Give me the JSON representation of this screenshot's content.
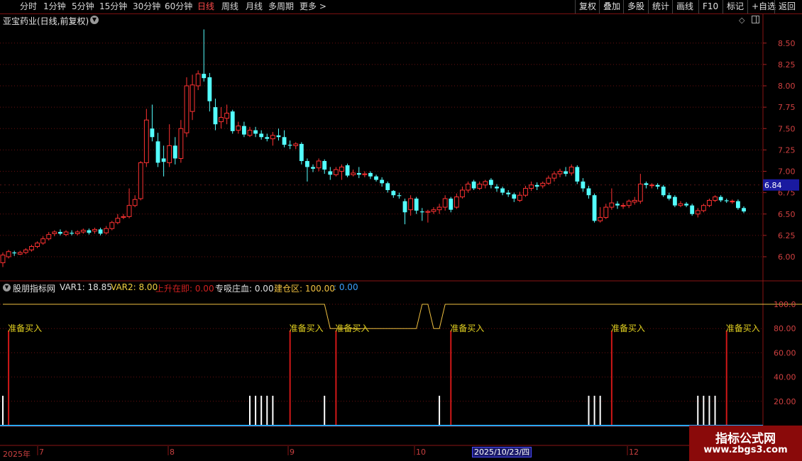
{
  "toolbar": {
    "periods": [
      "分时",
      "1分钟",
      "5分钟",
      "15分钟",
      "30分钟",
      "60分钟",
      "日线",
      "周线",
      "月线",
      "多周期",
      "更多 >"
    ],
    "active_period": "日线",
    "right_buttons": [
      "复权",
      "叠加",
      "多股",
      "统计",
      "画线",
      "F10",
      "标记",
      "+自选",
      "返回"
    ]
  },
  "stock": {
    "title": "亚宝药业(日线,前复权)"
  },
  "price_axis": {
    "ticks": [
      "8.50",
      "8.25",
      "8.00",
      "7.75",
      "7.50",
      "7.25",
      "7.00",
      "6.75",
      "6.50",
      "6.25",
      "6.00"
    ],
    "current": "6.84"
  },
  "indicator": {
    "name": "股朋指标网",
    "var1": "VAR1: 18.85",
    "var2": "VAR2: 8.00",
    "rise": "上升在即: 0.00",
    "absorb": "专吸庄血: 0.00",
    "build": "建仓区: 100.00",
    "extra": ": 0.00",
    "axis": [
      "100.0",
      "80.00",
      "60.00",
      "40.00",
      "20.00"
    ],
    "buy_label": "准备买入"
  },
  "dates": {
    "year": "2025年",
    "months": [
      "7",
      "8",
      "9",
      "10",
      "11",
      "12"
    ],
    "selected": "2025/10/23/四"
  },
  "watermark": {
    "text": "指标公式网",
    "url": "www.zbgs3.com"
  },
  "colors": {
    "up": "#ff3232",
    "down": "#54ffff",
    "line": "#f0c040",
    "buy": "#e0d020"
  },
  "chart_data": {
    "type": "candlestick",
    "title": "亚宝药业(日线,前复权)",
    "ylim": [
      5.9,
      8.75
    ],
    "candles": [
      {
        "o": 5.93,
        "c": 6.02,
        "h": 6.05,
        "l": 5.88
      },
      {
        "o": 6.0,
        "c": 6.06,
        "h": 6.08,
        "l": 5.98
      },
      {
        "o": 6.05,
        "c": 6.04,
        "h": 6.07,
        "l": 6.01
      },
      {
        "o": 6.03,
        "c": 6.05,
        "h": 6.07,
        "l": 6.02
      },
      {
        "o": 6.05,
        "c": 6.08,
        "h": 6.1,
        "l": 6.03
      },
      {
        "o": 6.08,
        "c": 6.12,
        "h": 6.14,
        "l": 6.06
      },
      {
        "o": 6.12,
        "c": 6.16,
        "h": 6.18,
        "l": 6.1
      },
      {
        "o": 6.16,
        "c": 6.21,
        "h": 6.24,
        "l": 6.14
      },
      {
        "o": 6.21,
        "c": 6.26,
        "h": 6.29,
        "l": 6.19
      },
      {
        "o": 6.27,
        "c": 6.29,
        "h": 6.31,
        "l": 6.24
      },
      {
        "o": 6.29,
        "c": 6.27,
        "h": 6.32,
        "l": 6.25
      },
      {
        "o": 6.26,
        "c": 6.29,
        "h": 6.31,
        "l": 6.24
      },
      {
        "o": 6.28,
        "c": 6.27,
        "h": 6.31,
        "l": 6.25
      },
      {
        "o": 6.27,
        "c": 6.29,
        "h": 6.31,
        "l": 6.25
      },
      {
        "o": 6.29,
        "c": 6.31,
        "h": 6.33,
        "l": 6.27
      },
      {
        "o": 6.31,
        "c": 6.28,
        "h": 6.33,
        "l": 6.26
      },
      {
        "o": 6.3,
        "c": 6.32,
        "h": 6.34,
        "l": 6.27
      },
      {
        "o": 6.32,
        "c": 6.27,
        "h": 6.34,
        "l": 6.25
      },
      {
        "o": 6.28,
        "c": 6.33,
        "h": 6.36,
        "l": 6.26
      },
      {
        "o": 6.33,
        "c": 6.4,
        "h": 6.42,
        "l": 6.31
      },
      {
        "o": 6.4,
        "c": 6.45,
        "h": 6.5,
        "l": 6.38
      },
      {
        "o": 6.46,
        "c": 6.47,
        "h": 6.5,
        "l": 6.44
      },
      {
        "o": 6.47,
        "c": 6.6,
        "h": 6.8,
        "l": 6.45
      },
      {
        "o": 6.6,
        "c": 6.67,
        "h": 6.72,
        "l": 6.58
      },
      {
        "o": 6.68,
        "c": 7.1,
        "h": 7.12,
        "l": 6.66
      },
      {
        "o": 7.1,
        "c": 7.6,
        "h": 7.73,
        "l": 7.05
      },
      {
        "o": 7.5,
        "c": 7.4,
        "h": 7.78,
        "l": 7.35
      },
      {
        "o": 7.35,
        "c": 7.1,
        "h": 7.45,
        "l": 7.05
      },
      {
        "o": 7.15,
        "c": 7.11,
        "h": 7.3,
        "l": 6.94
      },
      {
        "o": 7.1,
        "c": 7.3,
        "h": 7.55,
        "l": 7.05
      },
      {
        "o": 7.3,
        "c": 7.15,
        "h": 7.4,
        "l": 7.08
      },
      {
        "o": 7.15,
        "c": 7.5,
        "h": 7.6,
        "l": 7.1
      },
      {
        "o": 7.45,
        "c": 8.0,
        "h": 8.1,
        "l": 7.4
      },
      {
        "o": 7.7,
        "c": 8.01,
        "h": 8.13,
        "l": 7.6
      },
      {
        "o": 8.0,
        "c": 8.14,
        "h": 8.18,
        "l": 7.95
      },
      {
        "o": 8.14,
        "c": 8.09,
        "h": 8.66,
        "l": 8.05
      },
      {
        "o": 8.1,
        "c": 7.82,
        "h": 8.15,
        "l": 7.7
      },
      {
        "o": 7.75,
        "c": 7.55,
        "h": 7.85,
        "l": 7.48
      },
      {
        "o": 7.58,
        "c": 7.63,
        "h": 7.75,
        "l": 7.5
      },
      {
        "o": 7.62,
        "c": 7.68,
        "h": 7.78,
        "l": 7.55
      },
      {
        "o": 7.7,
        "c": 7.47,
        "h": 7.72,
        "l": 7.44
      },
      {
        "o": 7.48,
        "c": 7.53,
        "h": 7.58,
        "l": 7.44
      },
      {
        "o": 7.53,
        "c": 7.43,
        "h": 7.58,
        "l": 7.4
      },
      {
        "o": 7.42,
        "c": 7.48,
        "h": 7.52,
        "l": 7.4
      },
      {
        "o": 7.48,
        "c": 7.44,
        "h": 7.52,
        "l": 7.4
      },
      {
        "o": 7.44,
        "c": 7.4,
        "h": 7.48,
        "l": 7.37
      },
      {
        "o": 7.4,
        "c": 7.38,
        "h": 7.44,
        "l": 7.35
      },
      {
        "o": 7.38,
        "c": 7.42,
        "h": 7.46,
        "l": 7.3
      },
      {
        "o": 7.42,
        "c": 7.4,
        "h": 7.5,
        "l": 7.36
      },
      {
        "o": 7.4,
        "c": 7.31,
        "h": 7.48,
        "l": 7.28
      },
      {
        "o": 7.31,
        "c": 7.3,
        "h": 7.36,
        "l": 7.26
      },
      {
        "o": 7.3,
        "c": 7.32,
        "h": 7.34,
        "l": 7.26
      },
      {
        "o": 7.32,
        "c": 7.12,
        "h": 7.34,
        "l": 7.08
      },
      {
        "o": 7.12,
        "c": 7.05,
        "h": 7.15,
        "l": 6.88
      },
      {
        "o": 7.05,
        "c": 7.03,
        "h": 7.08,
        "l": 6.99
      },
      {
        "o": 7.04,
        "c": 7.12,
        "h": 7.15,
        "l": 7.0
      },
      {
        "o": 7.12,
        "c": 7.02,
        "h": 7.14,
        "l": 6.97
      },
      {
        "o": 7.0,
        "c": 6.96,
        "h": 7.05,
        "l": 6.9
      },
      {
        "o": 6.96,
        "c": 7.02,
        "h": 7.05,
        "l": 6.94
      },
      {
        "o": 7.0,
        "c": 7.05,
        "h": 7.08,
        "l": 6.9
      },
      {
        "o": 7.07,
        "c": 6.95,
        "h": 7.09,
        "l": 6.93
      },
      {
        "o": 6.96,
        "c": 6.98,
        "h": 7.02,
        "l": 6.94
      },
      {
        "o": 6.98,
        "c": 6.96,
        "h": 7.05,
        "l": 6.92
      },
      {
        "o": 6.96,
        "c": 6.97,
        "h": 7.0,
        "l": 6.93
      },
      {
        "o": 6.98,
        "c": 6.94,
        "h": 7.0,
        "l": 6.91
      },
      {
        "o": 6.94,
        "c": 6.9,
        "h": 6.96,
        "l": 6.88
      },
      {
        "o": 6.9,
        "c": 6.86,
        "h": 6.93,
        "l": 6.82
      },
      {
        "o": 6.86,
        "c": 6.78,
        "h": 6.88,
        "l": 6.75
      },
      {
        "o": 6.77,
        "c": 6.72,
        "h": 6.78,
        "l": 6.69
      },
      {
        "o": 6.72,
        "c": 6.71,
        "h": 6.75,
        "l": 6.68
      },
      {
        "o": 6.65,
        "c": 6.52,
        "h": 6.68,
        "l": 6.38
      },
      {
        "o": 6.55,
        "c": 6.68,
        "h": 6.72,
        "l": 6.48
      },
      {
        "o": 6.68,
        "c": 6.54,
        "h": 6.7,
        "l": 6.5
      },
      {
        "o": 6.53,
        "c": 6.52,
        "h": 6.57,
        "l": 6.42
      },
      {
        "o": 6.52,
        "c": 6.53,
        "h": 6.55,
        "l": 6.4
      },
      {
        "o": 6.53,
        "c": 6.55,
        "h": 6.58,
        "l": 6.5
      },
      {
        "o": 6.55,
        "c": 6.58,
        "h": 6.62,
        "l": 6.5
      },
      {
        "o": 6.58,
        "c": 6.68,
        "h": 6.72,
        "l": 6.54
      },
      {
        "o": 6.68,
        "c": 6.55,
        "h": 6.7,
        "l": 6.52
      },
      {
        "o": 6.58,
        "c": 6.7,
        "h": 6.74,
        "l": 6.56
      },
      {
        "o": 6.7,
        "c": 6.78,
        "h": 6.82,
        "l": 6.68
      },
      {
        "o": 6.78,
        "c": 6.85,
        "h": 6.88,
        "l": 6.75
      },
      {
        "o": 6.88,
        "c": 6.8,
        "h": 6.9,
        "l": 6.78
      },
      {
        "o": 6.8,
        "c": 6.85,
        "h": 6.88,
        "l": 6.78
      },
      {
        "o": 6.84,
        "c": 6.88,
        "h": 6.9,
        "l": 6.8
      },
      {
        "o": 6.9,
        "c": 6.84,
        "h": 6.92,
        "l": 6.8
      },
      {
        "o": 6.82,
        "c": 6.8,
        "h": 6.85,
        "l": 6.76
      },
      {
        "o": 6.8,
        "c": 6.75,
        "h": 6.82,
        "l": 6.72
      },
      {
        "o": 6.75,
        "c": 6.73,
        "h": 6.78,
        "l": 6.7
      },
      {
        "o": 6.73,
        "c": 6.68,
        "h": 6.75,
        "l": 6.64
      },
      {
        "o": 6.66,
        "c": 6.72,
        "h": 6.76,
        "l": 6.64
      },
      {
        "o": 6.72,
        "c": 6.8,
        "h": 6.83,
        "l": 6.7
      },
      {
        "o": 6.8,
        "c": 6.84,
        "h": 6.88,
        "l": 6.77
      },
      {
        "o": 6.84,
        "c": 6.82,
        "h": 6.87,
        "l": 6.78
      },
      {
        "o": 6.83,
        "c": 6.86,
        "h": 6.88,
        "l": 6.8
      },
      {
        "o": 6.86,
        "c": 6.92,
        "h": 6.95,
        "l": 6.84
      },
      {
        "o": 6.92,
        "c": 6.97,
        "h": 7.0,
        "l": 6.88
      },
      {
        "o": 6.97,
        "c": 7.0,
        "h": 7.03,
        "l": 6.93
      },
      {
        "o": 7.0,
        "c": 6.97,
        "h": 7.05,
        "l": 6.94
      },
      {
        "o": 6.98,
        "c": 7.05,
        "h": 7.08,
        "l": 6.95
      },
      {
        "o": 7.05,
        "c": 6.88,
        "h": 7.07,
        "l": 6.85
      },
      {
        "o": 6.88,
        "c": 6.8,
        "h": 6.92,
        "l": 6.76
      },
      {
        "o": 6.8,
        "c": 6.72,
        "h": 6.83,
        "l": 6.68
      },
      {
        "o": 6.72,
        "c": 6.42,
        "h": 6.74,
        "l": 6.4
      },
      {
        "o": 6.42,
        "c": 6.46,
        "h": 6.58,
        "l": 6.4
      },
      {
        "o": 6.46,
        "c": 6.58,
        "h": 6.62,
        "l": 6.44
      },
      {
        "o": 6.58,
        "c": 6.63,
        "h": 6.8,
        "l": 6.55
      },
      {
        "o": 6.62,
        "c": 6.6,
        "h": 6.65,
        "l": 6.56
      },
      {
        "o": 6.6,
        "c": 6.6,
        "h": 6.63,
        "l": 6.56
      },
      {
        "o": 6.6,
        "c": 6.65,
        "h": 6.67,
        "l": 6.57
      },
      {
        "o": 6.64,
        "c": 6.66,
        "h": 6.7,
        "l": 6.61
      },
      {
        "o": 6.65,
        "c": 6.85,
        "h": 6.97,
        "l": 6.62
      },
      {
        "o": 6.86,
        "c": 6.84,
        "h": 6.88,
        "l": 6.8
      },
      {
        "o": 6.84,
        "c": 6.84,
        "h": 6.86,
        "l": 6.8
      },
      {
        "o": 6.84,
        "c": 6.82,
        "h": 6.86,
        "l": 6.79
      },
      {
        "o": 6.82,
        "c": 6.72,
        "h": 6.84,
        "l": 6.7
      },
      {
        "o": 6.72,
        "c": 6.68,
        "h": 6.75,
        "l": 6.66
      },
      {
        "o": 6.7,
        "c": 6.6,
        "h": 6.72,
        "l": 6.58
      },
      {
        "o": 6.6,
        "c": 6.62,
        "h": 6.65,
        "l": 6.58
      },
      {
        "o": 6.62,
        "c": 6.6,
        "h": 6.64,
        "l": 6.58
      },
      {
        "o": 6.6,
        "c": 6.5,
        "h": 6.62,
        "l": 6.48
      },
      {
        "o": 6.5,
        "c": 6.54,
        "h": 6.57,
        "l": 6.46
      },
      {
        "o": 6.54,
        "c": 6.6,
        "h": 6.62,
        "l": 6.52
      },
      {
        "o": 6.6,
        "c": 6.66,
        "h": 6.68,
        "l": 6.58
      },
      {
        "o": 6.66,
        "c": 6.7,
        "h": 6.72,
        "l": 6.64
      },
      {
        "o": 6.7,
        "c": 6.66,
        "h": 6.72,
        "l": 6.64
      },
      {
        "o": 6.66,
        "c": 6.65,
        "h": 6.68,
        "l": 6.63
      },
      {
        "o": 6.65,
        "c": 6.65,
        "h": 6.67,
        "l": 6.62
      },
      {
        "o": 6.65,
        "c": 6.57,
        "h": 6.67,
        "l": 6.55
      },
      {
        "o": 6.57,
        "c": 6.53,
        "h": 6.59,
        "l": 6.51
      }
    ],
    "indicator": {
      "level_line": [
        100,
        100,
        100,
        100,
        100,
        100,
        100,
        100,
        100,
        100,
        100,
        100,
        100,
        100,
        100,
        100,
        100,
        100,
        100,
        100,
        100,
        100,
        100,
        100,
        100,
        100,
        100,
        100,
        100,
        100,
        100,
        100,
        100,
        100,
        100,
        100,
        100,
        100,
        100,
        100,
        100,
        100,
        100,
        100,
        100,
        100,
        100,
        100,
        100,
        100,
        100,
        100,
        100,
        100,
        100,
        100,
        100,
        80,
        80,
        80,
        80,
        80,
        80,
        80,
        80,
        80,
        80,
        80,
        80,
        80,
        80,
        80,
        80,
        100,
        100,
        80,
        80,
        100,
        100,
        100,
        100,
        100,
        100,
        100,
        100,
        100,
        100,
        100,
        100,
        100,
        100,
        100,
        100,
        100,
        100,
        100,
        100,
        100,
        100,
        100,
        100,
        100,
        100,
        100,
        100,
        100,
        100,
        100,
        100,
        100,
        100,
        100,
        100,
        100,
        100,
        100,
        100,
        100,
        100,
        100,
        100,
        100,
        100,
        100,
        100,
        100,
        100,
        100,
        100,
        100,
        100,
        100,
        100,
        100,
        100,
        100,
        100,
        100,
        100,
        100,
        100,
        100,
        100,
        100,
        100,
        100,
        100,
        100,
        100,
        100,
        100,
        100,
        100
      ],
      "buy_signals_at": [
        1,
        50,
        58,
        78,
        106,
        126,
        147
      ],
      "white_bars_at": [
        0,
        43,
        44,
        45,
        46,
        47,
        56,
        76,
        102,
        103,
        104,
        121,
        122,
        123,
        124,
        142,
        143,
        144,
        145
      ]
    }
  }
}
